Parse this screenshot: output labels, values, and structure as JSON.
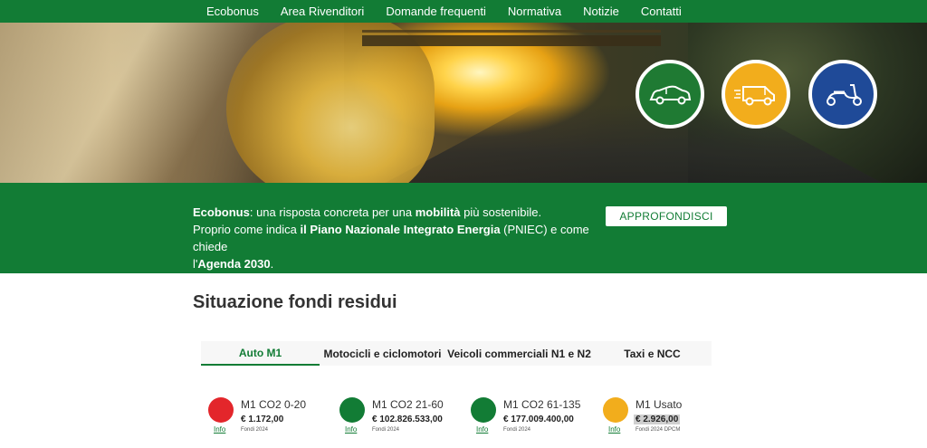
{
  "nav": {
    "items": [
      "Ecobonus",
      "Area Rivenditori",
      "Domande frequenti",
      "Normativa",
      "Notizie",
      "Contatti"
    ]
  },
  "hero": {
    "vehicle_icons": [
      "car-icon",
      "van-icon",
      "scooter-icon"
    ],
    "colors": {
      "car": "#1f7a33",
      "van": "#f2ad1c",
      "scooter": "#1f4a98"
    }
  },
  "band": {
    "line1_strong": "Ecobonus",
    "line1_a": ": una risposta concreta per una ",
    "line1_strong2": "mobilità",
    "line1_b": " più sostenibile.",
    "line2_a": "Proprio come indica ",
    "line2_strong": "il Piano Nazionale Integrato Energia",
    "line2_b": " (PNIEC) e come chiede",
    "line3_a": "l'",
    "line3_strong": "Agenda 2030",
    "line3_b": ".",
    "button": "APPROFONDISCI"
  },
  "funds": {
    "title": "Situazione fondi residui",
    "tabs": [
      "Auto M1",
      "Motocicli e ciclomotori",
      "Veicoli commerciali N1 e N2",
      "Taxi e NCC"
    ],
    "active_tab": 0,
    "items": [
      {
        "name": "M1 CO2 0-20",
        "amount": "€ 1.172,00",
        "sub": "Fondi 2024",
        "info": "Info",
        "color": "#e3262b"
      },
      {
        "name": "M1 CO2 21-60",
        "amount": "€ 102.826.533,00",
        "sub": "Fondi 2024",
        "info": "Info",
        "color": "#127c35"
      },
      {
        "name": "M1 CO2 61-135",
        "amount": "€ 177.009.400,00",
        "sub": "Fondi 2024",
        "info": "Info",
        "color": "#127c35"
      },
      {
        "name": "M1 Usato",
        "amount": "€ 2.926,00",
        "sub": "Fondi 2024 DPCM",
        "info": "Info",
        "color": "#f2ad1c"
      }
    ]
  },
  "colors": {
    "brand_green": "#127c35",
    "white": "#ffffff"
  }
}
